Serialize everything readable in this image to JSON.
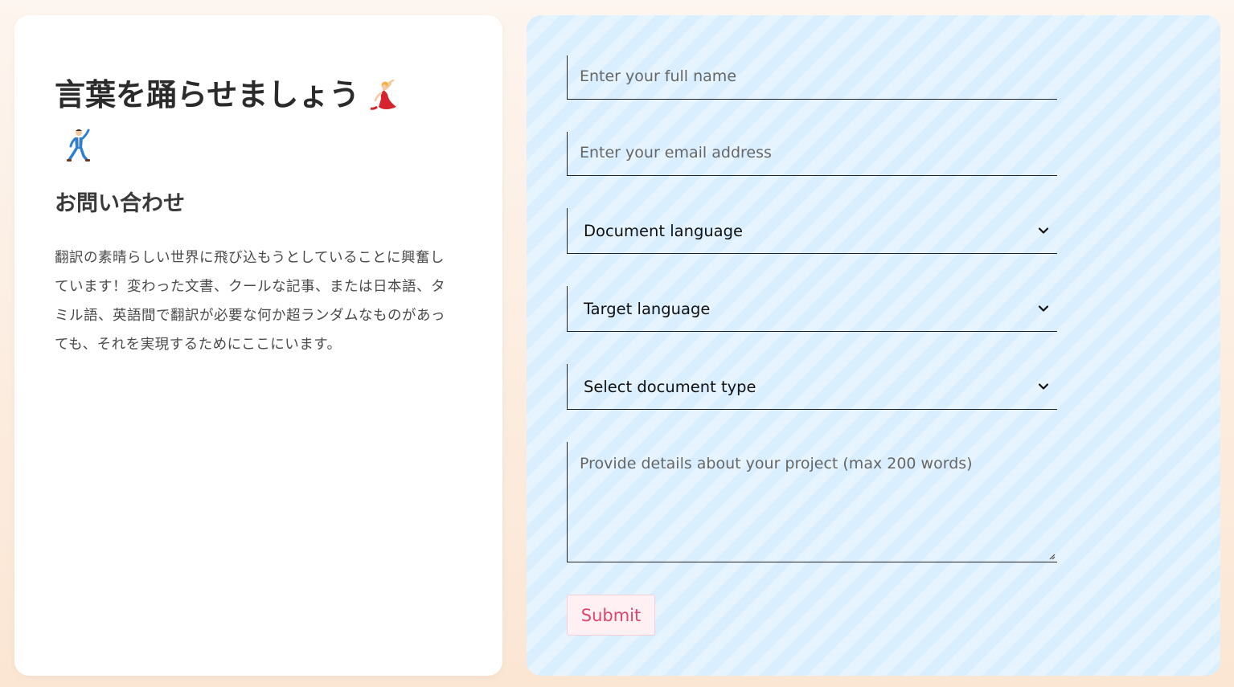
{
  "intro_panel": {
    "title": "言葉を踊らせましょう",
    "emoji_1": "dancing-woman-emoji",
    "emoji_2": "dancing-man-emoji",
    "subtitle": "お問い合わせ",
    "description": "翻訳の素晴らしい世界に飛び込もうとしていることに興奮しています！変わった文書、クールな記事、または日本語、タミル語、英語間で翻訳が必要な何か超ランダムなものがあっても、それを実現するためにここにいます。"
  },
  "form": {
    "name_placeholder": "Enter your full name",
    "email_placeholder": "Enter your email address",
    "document_language": "Document language",
    "target_language": "Target language",
    "document_type": "Select document type",
    "details_placeholder": "Provide details about your project (max 200 words)",
    "submit_label": "Submit"
  },
  "colors": {
    "form_panel_bg": "#d9eeff",
    "submit_text": "#e0456b",
    "submit_bg": "#fff0f3"
  }
}
